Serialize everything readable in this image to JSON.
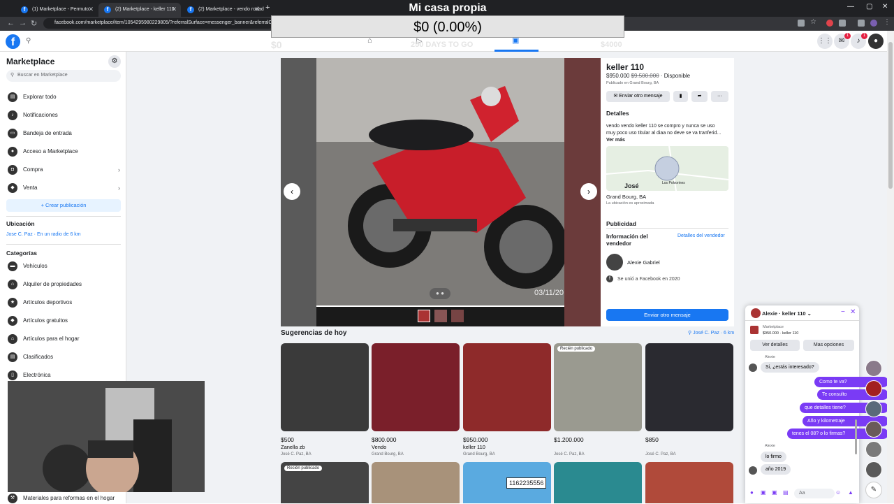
{
  "browser": {
    "tabs": [
      {
        "label": "(1) Marketplace - Permuto"
      },
      {
        "label": "(2) Marketplace - keller 110"
      },
      {
        "label": "(2) Marketplace - vendo rodad"
      }
    ],
    "new_tab": "+",
    "url": "facebook.com/marketplace/item/1054295980229805/?referralSurface=messenger_banner&referralC"
  },
  "overlay": {
    "title": "Mi casa propia",
    "amount": "$0 (0.00%)",
    "left_value": "$0",
    "days": "250 DAYS TO GO",
    "goal": "$4000"
  },
  "sidebar": {
    "title": "Marketplace",
    "search_placeholder": "Buscar en Marketplace",
    "items": [
      {
        "label": "Explorar todo"
      },
      {
        "label": "Notificaciones"
      },
      {
        "label": "Bandeja de entrada"
      },
      {
        "label": "Acceso a Marketplace"
      },
      {
        "label": "Compra"
      },
      {
        "label": "Venta"
      }
    ],
    "create_label": "+ Crear publicación",
    "location_heading": "Ubicación",
    "location_value": "Jose C. Paz · En un radio de 6 km",
    "categories_heading": "Categorías",
    "categories": [
      {
        "label": "Vehículos"
      },
      {
        "label": "Alquiler de propiedades"
      },
      {
        "label": "Artículos deportivos"
      },
      {
        "label": "Artículos gratuitos"
      },
      {
        "label": "Artículos para el hogar"
      },
      {
        "label": "Clasificados"
      },
      {
        "label": "Electrónica"
      }
    ],
    "bottom_item": "Materiales para reformas en el hogar"
  },
  "photo": {
    "timestamp": "03/11/20"
  },
  "listing": {
    "title": "keller 110",
    "price": "$950.000",
    "old_price": "$9.500.000",
    "status": "· Disponible",
    "published": "Publicado en Grand Bourg, BA",
    "send_btn": "Enviar otro mensaje",
    "details_heading": "Detalles",
    "description": "vendo vendo keller 110 se compro y nunca se uso muy poco uso titular al diaa no deve se va tranferid...",
    "more": "Ver más",
    "map_label": "José",
    "map_label2": "Los Polvorines",
    "location": "Grand Bourg, BA",
    "location_note": "La ubicación es aproximada",
    "publicity": "Publicidad",
    "seller_info": "Información del vendedor",
    "seller_details": "Detalles del vendedor",
    "seller_name": "Alexie Gabriel",
    "joined": "Se unió a Facebook en 2020",
    "bottom_btn": "Enviar otro mensaje"
  },
  "suggestions": {
    "heading": "Sugerencias de hoy",
    "location": "José C. Paz · 6 km",
    "items": [
      {
        "price": "$500",
        "title": "Zanella zb",
        "loc": "José C. Paz, BA",
        "color": "#3a3a3a"
      },
      {
        "price": "$800.000",
        "title": "Vendo",
        "loc": "Grand Bourg, BA",
        "color": "#7a1f2a"
      },
      {
        "price": "$950.000",
        "title": "keller 110",
        "loc": "Grand Bourg, BA",
        "color": "#8e2a2a"
      },
      {
        "price": "$1.200.000",
        "title": "",
        "loc": "José C. Paz, BA",
        "color": "#9a9a90",
        "badge": "Recién publicado"
      },
      {
        "price": "$850",
        "title": "",
        "loc": "José C. Paz, BA",
        "color": "#2a2a30"
      }
    ],
    "row2": [
      {
        "color": "#444",
        "badge": "Recién publicado"
      },
      {
        "color": "#a8927a"
      },
      {
        "color": "#5aaae0",
        "phone": "1162235556"
      },
      {
        "color": "#2a8a90"
      },
      {
        "color": "#b04a3a"
      }
    ]
  },
  "chat": {
    "title": "Alexie · keller 110",
    "sub1": "Marketplace",
    "sub2": "$950.000 · keller 110",
    "btn1": "Ver detalles",
    "btn2": "Mas opciones",
    "sender": "Alexie",
    "messages_in": [
      "Si, ¿estás interesado?"
    ],
    "messages_out": [
      "Como te va?",
      "Te consulto",
      "que detalles tiene?",
      "Año y kilometraje",
      "tenes el 08? o lo firmas?"
    ],
    "sender2": "Alexie",
    "replies": [
      "lo firmo",
      "año 2019"
    ],
    "input_placeholder": "Aa"
  }
}
